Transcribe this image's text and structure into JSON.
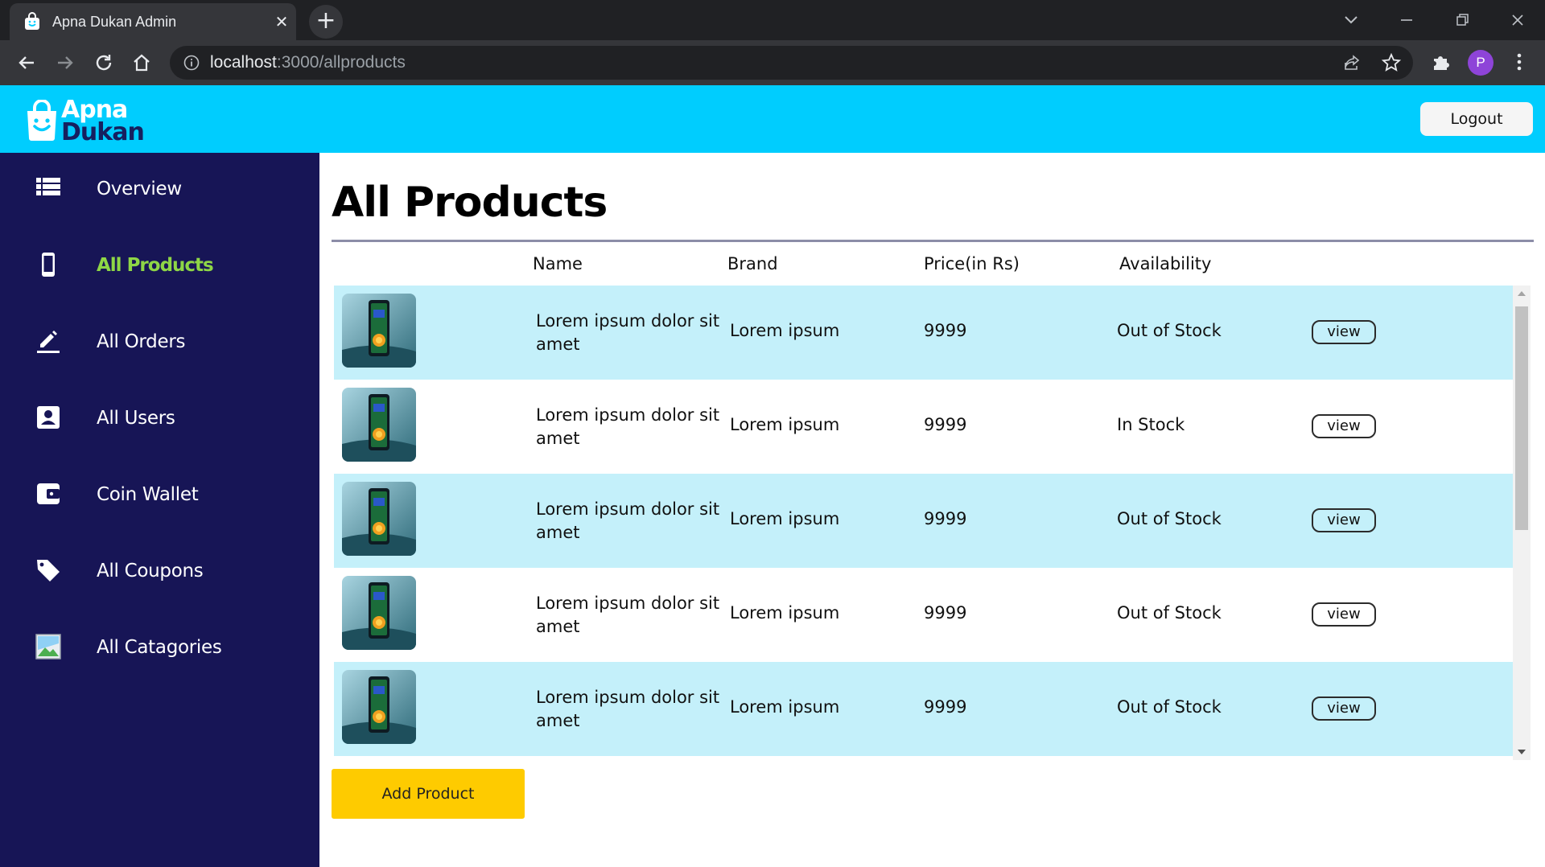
{
  "browser": {
    "tab_title": "Apna Dukan Admin",
    "url_host": "localhost",
    "url_path": ":3000/allproducts",
    "profile_initial": "P"
  },
  "header": {
    "logo_line1": "Apna",
    "logo_line2": "Dukan",
    "logout_label": "Logout",
    "accent_color": "#00cdfe"
  },
  "sidebar": {
    "items": [
      {
        "label": "Overview",
        "icon": "list-icon",
        "active": false
      },
      {
        "label": "All Products",
        "icon": "smartphone-icon",
        "active": true
      },
      {
        "label": "All Orders",
        "icon": "edit-icon",
        "active": false
      },
      {
        "label": "All Users",
        "icon": "contact-icon",
        "active": false
      },
      {
        "label": "Coin Wallet",
        "icon": "wallet-icon",
        "active": false
      },
      {
        "label": "All Coupons",
        "icon": "tag-icon",
        "active": false
      },
      {
        "label": "All Catagories",
        "icon": "broken-image-icon",
        "active": false
      }
    ],
    "background": "#171556",
    "active_color": "#8ed646"
  },
  "main": {
    "title": "All Products",
    "columns": [
      "Name",
      "Brand",
      "Price(in Rs)",
      "Availability"
    ],
    "rows": [
      {
        "name": "Lorem ipsum dolor sit amet",
        "brand": "Lorem ipsum",
        "price": "9999",
        "availability": "Out of Stock",
        "action": "view"
      },
      {
        "name": "Lorem ipsum dolor sit amet",
        "brand": "Lorem ipsum",
        "price": "9999",
        "availability": "In Stock",
        "action": "view"
      },
      {
        "name": "Lorem ipsum dolor sit amet",
        "brand": "Lorem ipsum",
        "price": "9999",
        "availability": "Out of Stock",
        "action": "view"
      },
      {
        "name": "Lorem ipsum dolor sit amet",
        "brand": "Lorem ipsum",
        "price": "9999",
        "availability": "Out of Stock",
        "action": "view"
      },
      {
        "name": "Lorem ipsum dolor sit amet",
        "brand": "Lorem ipsum",
        "price": "9999",
        "availability": "Out of Stock",
        "action": "view"
      }
    ],
    "add_button_label": "Add Product",
    "add_button_color": "#fecb00"
  }
}
